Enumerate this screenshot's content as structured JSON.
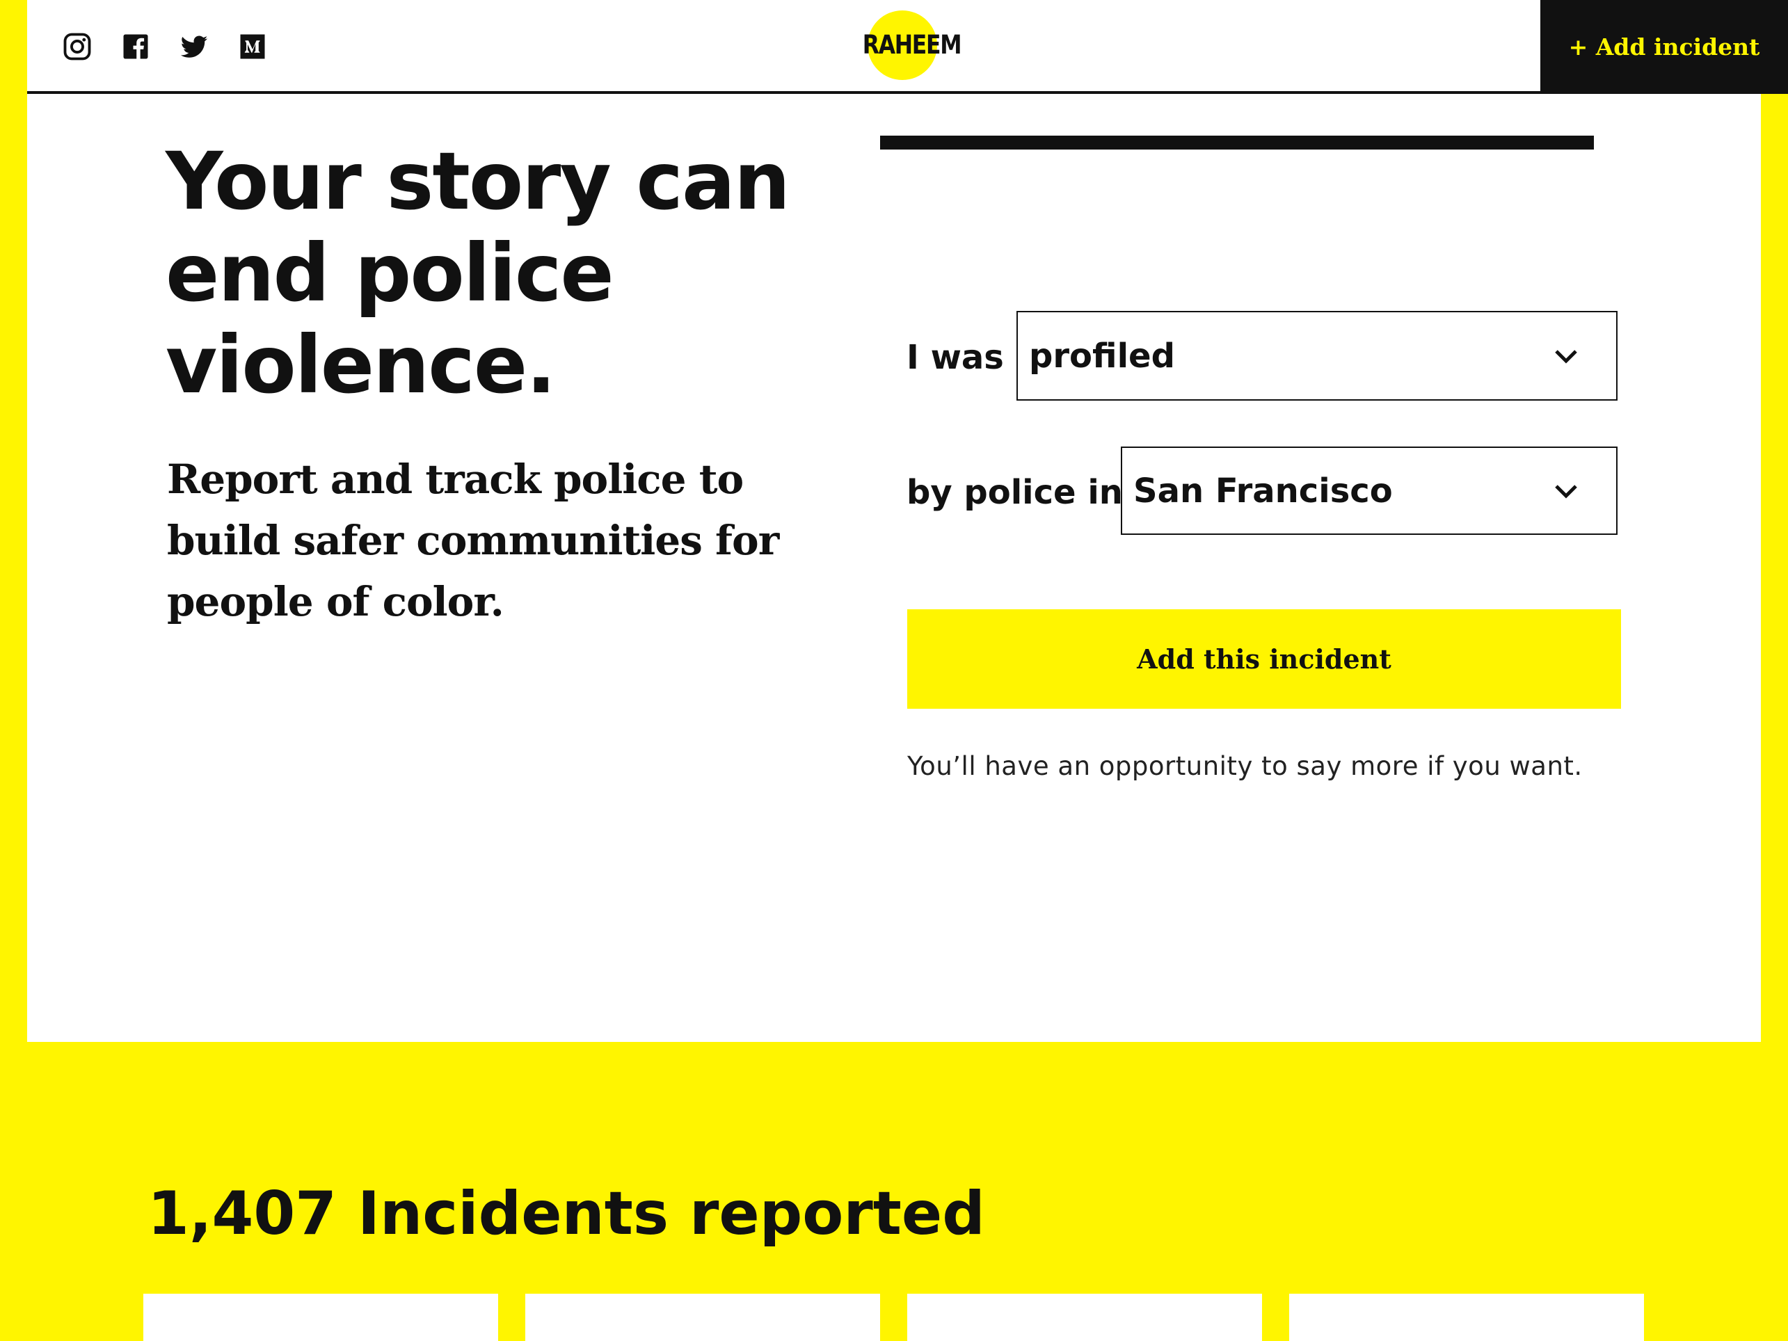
{
  "header": {
    "social_icons": [
      "instagram-icon",
      "facebook-icon",
      "twitter-icon",
      "medium-icon"
    ],
    "logo_text": "RAHEEM",
    "add_incident_label": "+ Add incident"
  },
  "hero": {
    "headline": "Your story can end police violence.",
    "subheadline": "Report and track police to build safer communities for people of color."
  },
  "form": {
    "label_was": "I was",
    "incident_type": "profiled",
    "label_by_police": "by police in",
    "city": "San Francisco",
    "submit_label": "Add this incident",
    "note": "You’ll have an opportunity to say more if you want."
  },
  "incidents": {
    "heading": "1,407 Incidents reported"
  },
  "colors": {
    "brand_yellow": "#FFF500",
    "dark": "#111111"
  }
}
